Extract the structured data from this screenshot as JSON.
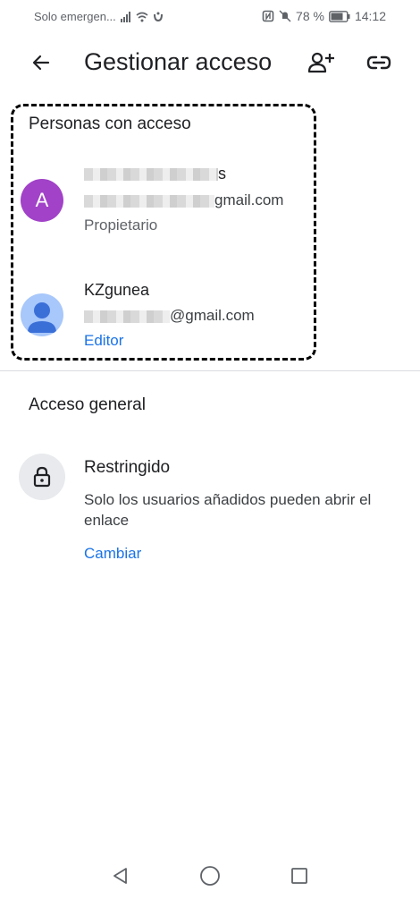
{
  "status_bar": {
    "carrier": "Solo emergen...",
    "battery": "78 %",
    "time": "14:12",
    "icons": [
      "signal-icon",
      "wifi-icon",
      "sync-icon",
      "nfc-icon",
      "mute-icon",
      "battery-icon"
    ]
  },
  "app_bar": {
    "title": "Gestionar acceso",
    "icons": [
      "back-arrow-icon",
      "add-person-icon",
      "link-icon"
    ]
  },
  "people_section": {
    "title": "Personas con acceso",
    "people": [
      {
        "avatar_letter": "A",
        "avatar_color": "#a142c8",
        "name_visible": "s",
        "email_visible": "gmail.com",
        "role": "Propietario"
      },
      {
        "avatar_icon": "person-avatar-icon",
        "avatar_color": "#a8c7fa",
        "name": "KZgunea",
        "email_visible": "@gmail.com",
        "role": "Editor"
      }
    ]
  },
  "general_access": {
    "title": "Acceso general",
    "icon": "lock-icon",
    "label": "Restringido",
    "description": "Solo los usuarios añadidos pueden abrir el enlace",
    "change_label": "Cambiar"
  },
  "nav_bar": {
    "icons": [
      "back-triangle-icon",
      "home-circle-icon",
      "recents-square-icon"
    ]
  },
  "colors": {
    "accent": "#1a73e8",
    "owner_avatar": "#a142c8"
  }
}
